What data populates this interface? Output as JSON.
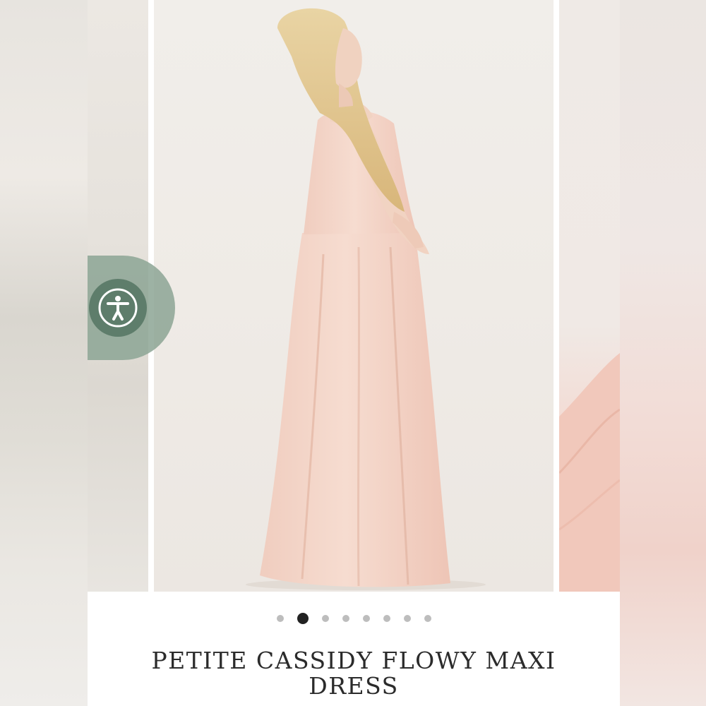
{
  "product": {
    "title": "PETITE CASSIDY FLOWY MAXI DRESS",
    "color_swatch": "#f2d4c8"
  },
  "carousel": {
    "slide_count": 8,
    "active_index": 1
  },
  "icons": {
    "zoom": "search-icon",
    "accessibility": "accessibility-icon"
  },
  "colors": {
    "accessibility_ring": "#8ca594",
    "accessibility_core": "#5e7d6b",
    "active_dot": "#222222",
    "inactive_dot": "#bdbdbd"
  }
}
